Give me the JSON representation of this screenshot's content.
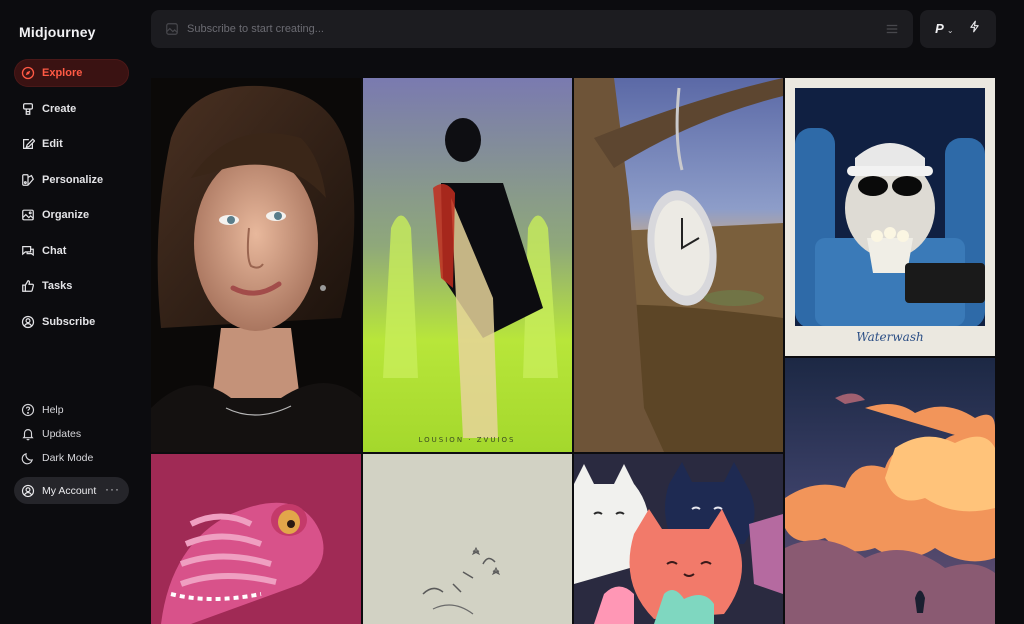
{
  "app": {
    "title": "Midjourney"
  },
  "nav": {
    "items": [
      {
        "label": "Explore",
        "icon": "compass-icon",
        "active": true
      },
      {
        "label": "Create",
        "icon": "brush-icon",
        "active": false
      },
      {
        "label": "Edit",
        "icon": "edit-icon",
        "active": false
      },
      {
        "label": "Personalize",
        "icon": "palette-icon",
        "active": false
      },
      {
        "label": "Organize",
        "icon": "gallery-icon",
        "active": false
      },
      {
        "label": "Chat",
        "icon": "chat-icon",
        "active": false
      },
      {
        "label": "Tasks",
        "icon": "thumbs-up-icon",
        "active": false
      },
      {
        "label": "Subscribe",
        "icon": "user-circle-icon",
        "active": false
      }
    ],
    "accent": "#ff5a45"
  },
  "bottom_nav": {
    "help": "Help",
    "updates": "Updates",
    "dark_mode": "Dark Mode",
    "account": "My Account",
    "account_more": "···"
  },
  "prompt": {
    "placeholder": "Subscribe to start creating...",
    "personalize_label": "P",
    "chevron": "⌄"
  },
  "gallery": {
    "items": [
      {
        "subject": "portrait-woman"
      },
      {
        "subject": "silhouette-figure",
        "caption": "LOUSION · ZVUIOS"
      },
      {
        "subject": "melting-pocket-watch"
      },
      {
        "subject": "cat-polaroid",
        "caption": "Waterwash"
      },
      {
        "subject": "pink-knit-dinosaur"
      },
      {
        "subject": "minimal-sketch"
      },
      {
        "subject": "felt-cats"
      },
      {
        "subject": "sunset-clouds"
      }
    ]
  }
}
